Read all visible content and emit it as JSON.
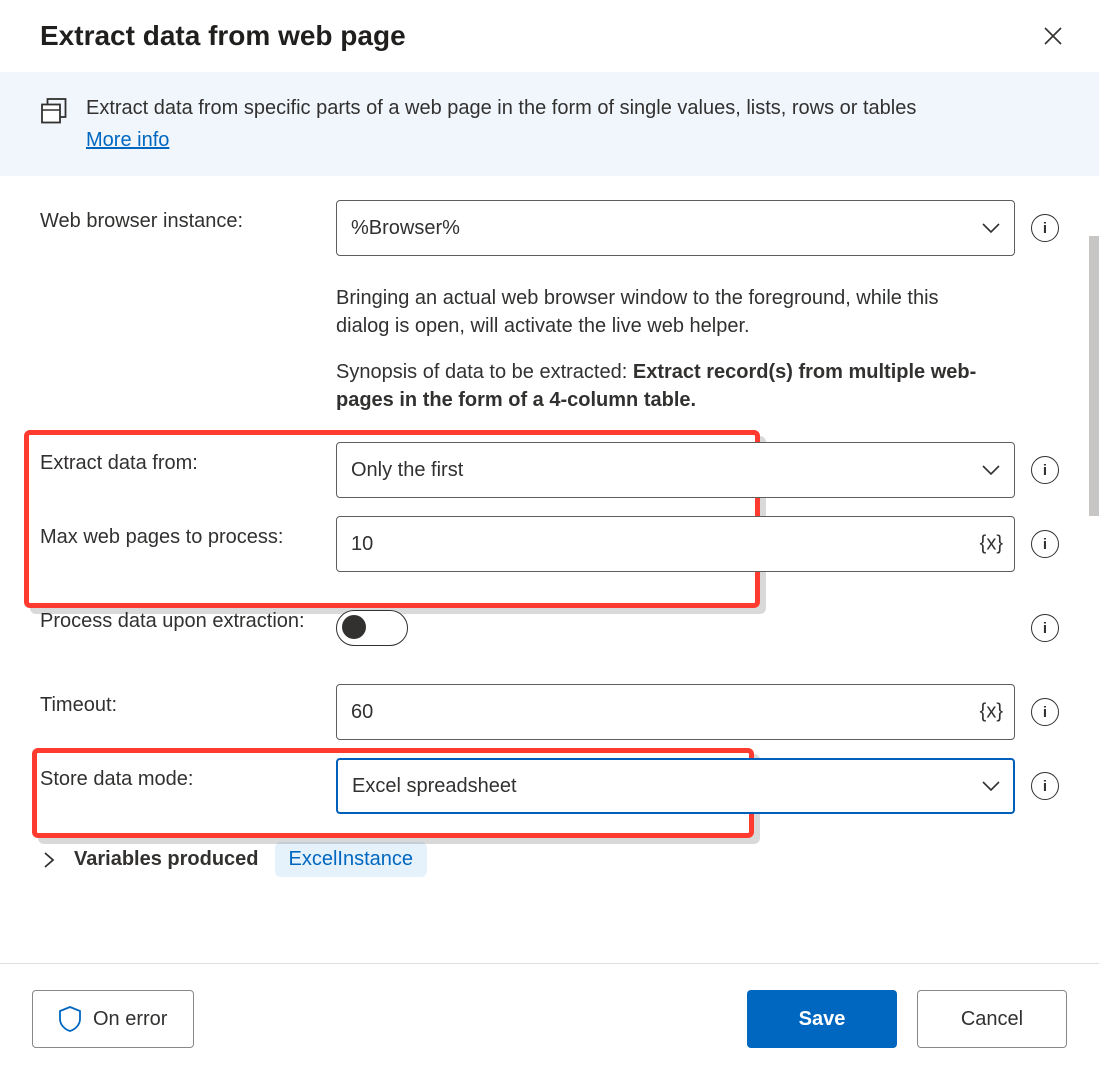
{
  "dialog": {
    "title": "Extract data from web page"
  },
  "banner": {
    "text": "Extract data from specific parts of a web page in the form of single values, lists, rows or tables",
    "more": "More info"
  },
  "helper": "Bringing an actual web browser window to the foreground, while this dialog is open, will activate the live web helper.",
  "synopsis": {
    "prefix": "Synopsis of data to be extracted: ",
    "bold": "Extract record(s) from multiple web-pages in the form of a 4-column table."
  },
  "fields": {
    "browser": {
      "label": "Web browser instance:",
      "value": "%Browser%"
    },
    "extractFrom": {
      "label": "Extract data from:",
      "value": "Only the first"
    },
    "maxPages": {
      "label": "Max web pages to process:",
      "value": "10"
    },
    "processOnExtract": {
      "label": "Process data upon extraction:"
    },
    "timeout": {
      "label": "Timeout:",
      "value": "60"
    },
    "storeMode": {
      "label": "Store data mode:",
      "value": "Excel spreadsheet"
    }
  },
  "variables": {
    "label": "Variables produced",
    "pill": "ExcelInstance"
  },
  "footer": {
    "onError": "On error",
    "save": "Save",
    "cancel": "Cancel"
  }
}
